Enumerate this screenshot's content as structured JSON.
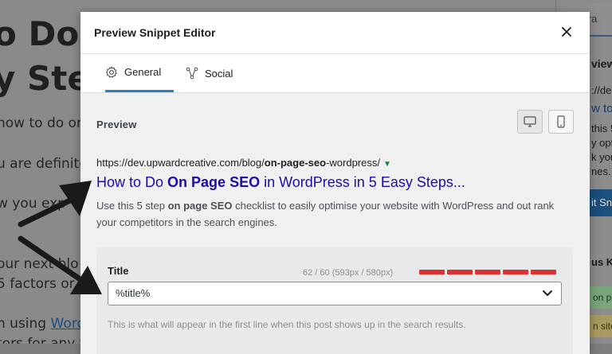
{
  "background": {
    "heading_lines": [
      "o Do O",
      "y Steps"
    ],
    "body_lines": [
      "how to do on",
      "u are definitely",
      "w you exp",
      "our next blo",
      "5 factors or"
    ],
    "last_line_prefix": "n using ",
    "last_line_link": "WordP",
    "cut_line": "tors for any ty",
    "sidebar": {
      "tab": "Genera",
      "texts": [
        "view",
        "://de",
        "w to",
        "this 5",
        "y opt",
        "k your",
        "nes."
      ],
      "button": "it Sni",
      "section": "us Ke",
      "pill_1": "on pa",
      "pill_2": "n site"
    }
  },
  "modal": {
    "title": "Preview Snippet Editor",
    "close_icon": "close-icon",
    "tabs": [
      {
        "label": "General",
        "icon": "gear-icon",
        "active": true
      },
      {
        "label": "Social",
        "icon": "share-icon",
        "active": false
      }
    ],
    "preview": {
      "label": "Preview",
      "desktop_icon": "desktop-icon",
      "mobile_icon": "mobile-icon",
      "url_prefix": "https://dev.upwardcreative.com/blog/",
      "url_bold": "on-page-seo",
      "url_suffix": "-wordpress/",
      "title_prefix": "How to Do ",
      "title_bold": "On Page SEO",
      "title_suffix": " in WordPress in 5 Easy Steps...",
      "desc_prefix": "Use this 5 step ",
      "desc_bold": "on page SEO",
      "desc_suffix": " checklist to easily optimise your website with WordPress and out rank your competitors in the search engines."
    },
    "title_field": {
      "label": "Title",
      "counter": "62 / 60 (593px / 580px)",
      "meter_fraction": 1.0,
      "meter_color": "#dc3232",
      "value": "%title%",
      "help": "This is what will appear in the first line when this post shows up in the search results."
    }
  }
}
